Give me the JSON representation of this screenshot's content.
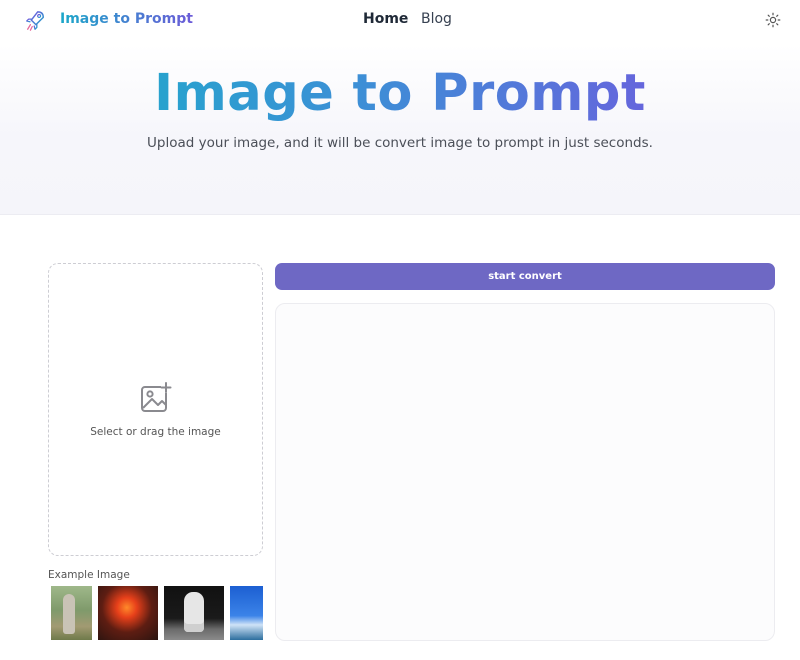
{
  "nav": {
    "brand": "Image to Prompt",
    "links": [
      {
        "label": "Home",
        "active": true
      },
      {
        "label": "Blog",
        "active": false
      }
    ],
    "theme_icon": "sun-icon"
  },
  "hero": {
    "title": "Image to Prompt",
    "subtitle": "Upload your image, and it will be convert image to prompt in just seconds."
  },
  "upload": {
    "icon": "image-plus-icon",
    "hint": "Select or drag the image"
  },
  "examples": {
    "label": "Example Image",
    "images": [
      "kangaroo",
      "volcano",
      "astronaut",
      "ocean"
    ]
  },
  "convert": {
    "button_label": "start convert",
    "output_text": ""
  },
  "colors": {
    "accent": "#6e68c4",
    "gradient_start": "#17b0c8",
    "gradient_end": "#7b4fe0"
  }
}
